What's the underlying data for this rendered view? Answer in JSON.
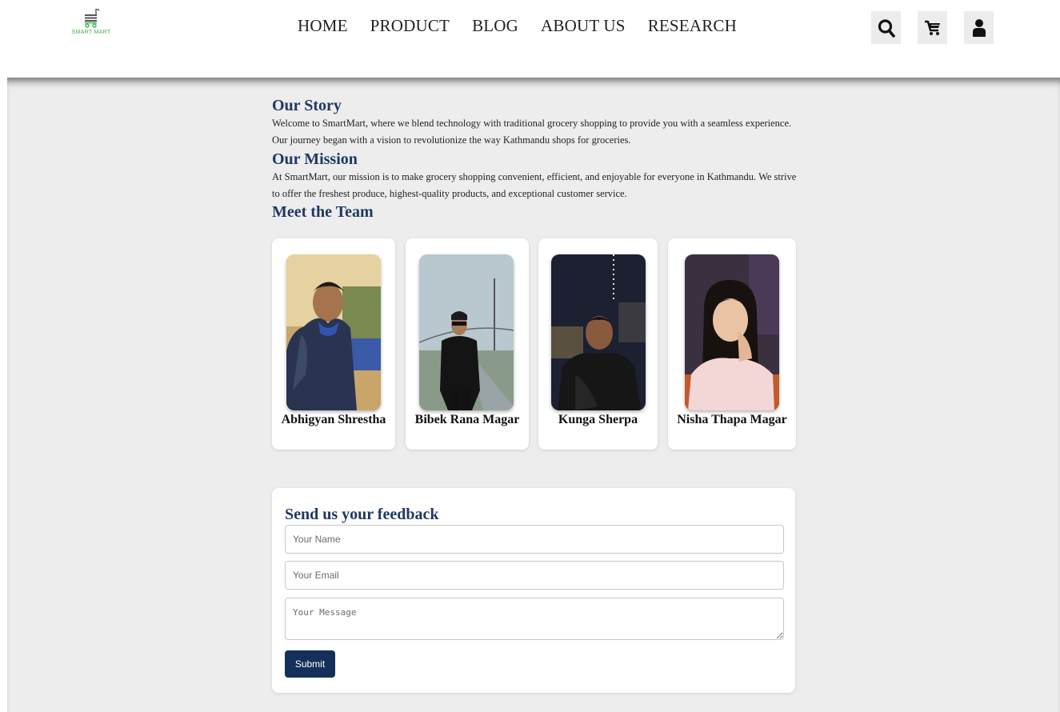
{
  "brand": {
    "name": "SMART MART",
    "accent": "#3bb54a"
  },
  "nav": {
    "items": [
      {
        "label": "HOME"
      },
      {
        "label": "PRODUCT"
      },
      {
        "label": "BLOG"
      },
      {
        "label": "ABOUT US"
      },
      {
        "label": "RESEARCH"
      }
    ]
  },
  "header_icons": [
    "search-icon",
    "cart-icon",
    "user-icon"
  ],
  "story": {
    "title": "Our Story",
    "line1": "Welcome to SmartMart, where we blend technology with traditional grocery shopping to provide you with a seamless experience.",
    "line2": "Our journey began with a vision to revolutionize the way Kathmandu shops for groceries."
  },
  "mission": {
    "title": "Our Mission",
    "line1": "At SmartMart, our mission is to make grocery shopping convenient, efficient, and enjoyable for everyone in Kathmandu. We strive",
    "line2": "to offer the freshest produce, highest-quality products, and exceptional customer service."
  },
  "team": {
    "title": "Meet the Team",
    "members": [
      {
        "name": "Abhigyan Shrestha"
      },
      {
        "name": "Bibek Rana Magar"
      },
      {
        "name": "Kunga Sherpa"
      },
      {
        "name": "Nisha Thapa Magar"
      }
    ]
  },
  "feedback": {
    "title": "Send us your feedback",
    "name_placeholder": "Your Name",
    "email_placeholder": "Your Email",
    "message_placeholder": "Your Message",
    "submit_label": "Submit"
  },
  "colors": {
    "heading": "#1f3864",
    "button": "#14305a",
    "background": "#ededed"
  }
}
